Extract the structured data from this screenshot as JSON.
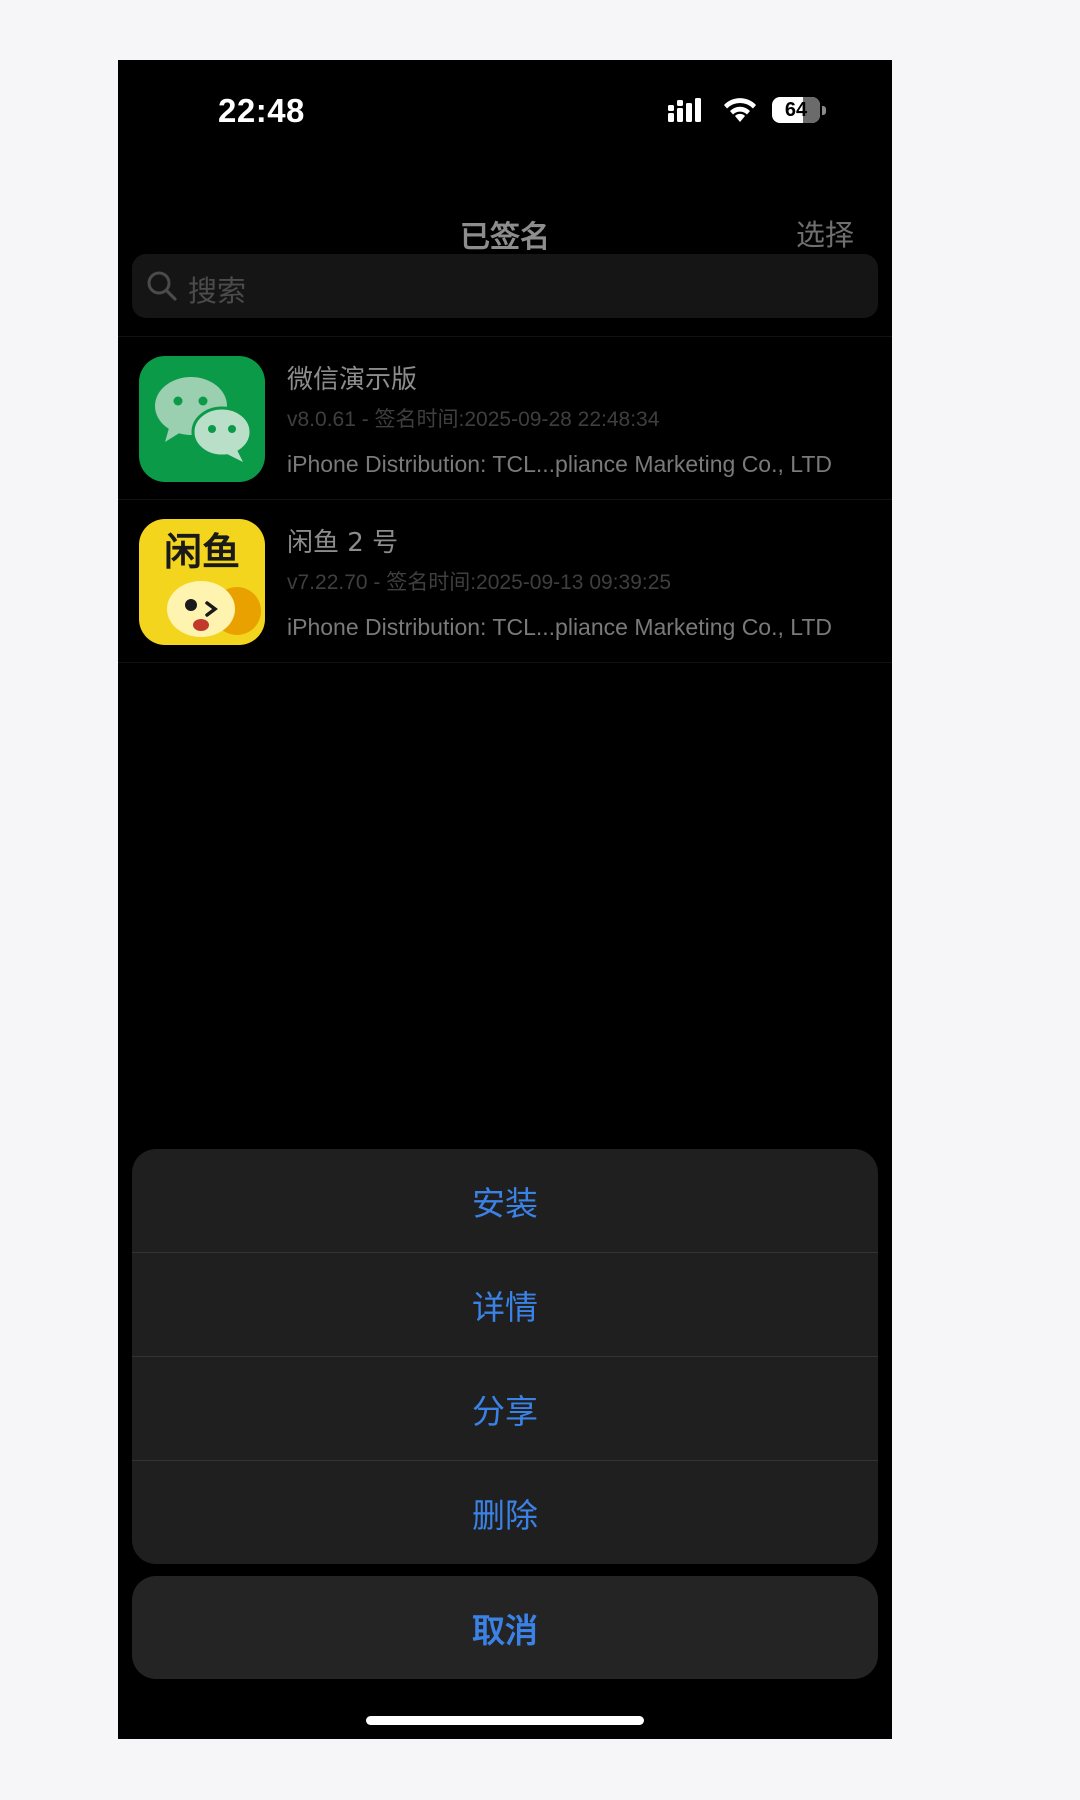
{
  "status_bar": {
    "time": "22:48",
    "battery": "64",
    "battery_level_percent": 64,
    "icons": [
      "cellular-signal-icon",
      "wifi-icon",
      "battery-icon"
    ]
  },
  "nav": {
    "title": "已签名",
    "select_label": "选择"
  },
  "search": {
    "placeholder": "搜索",
    "icon": "search-icon"
  },
  "apps": [
    {
      "name": "微信演示版",
      "meta": "v8.0.61 - 签名时间:2025-09-28 22:48:34",
      "cert": "iPhone Distribution: TCL...pliance Marketing Co., LTD",
      "icon": "wechat-app-icon"
    },
    {
      "name": "闲鱼 2 号",
      "meta": "v7.22.70 - 签名时间:2025-09-13 09:39:25",
      "cert": "iPhone Distribution: TCL...pliance Marketing Co., LTD",
      "icon": "xianyu-app-icon",
      "icon_text": "闲鱼"
    }
  ],
  "action_sheet": {
    "items": [
      "安装",
      "详情",
      "分享",
      "删除"
    ],
    "cancel": "取消"
  },
  "colors": {
    "accent": "#3b82e6",
    "background": "#000000",
    "sheet": "#1f1f1f",
    "wechat_green": "#0a9a48",
    "xianyu_yellow": "#f2d51c"
  }
}
